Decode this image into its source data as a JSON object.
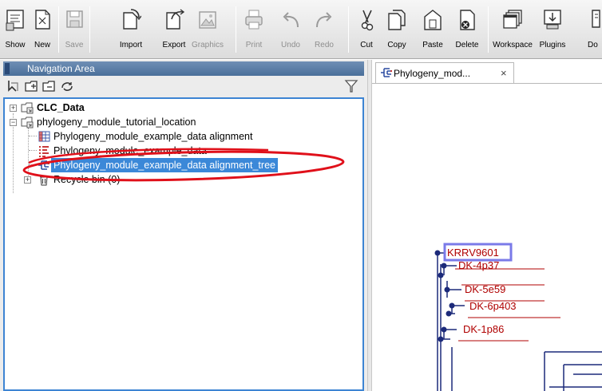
{
  "toolbar": {
    "buttons": [
      {
        "label": "Show",
        "enabled": true,
        "icon": "show-icon"
      },
      {
        "label": "New",
        "enabled": true,
        "icon": "new-icon"
      },
      {
        "label": "Save",
        "enabled": false,
        "icon": "save-icon"
      },
      {
        "label": "Import",
        "enabled": true,
        "icon": "import-icon"
      },
      {
        "label": "Export",
        "enabled": true,
        "icon": "export-icon"
      },
      {
        "label": "Graphics",
        "enabled": false,
        "icon": "graphics-icon"
      },
      {
        "label": "Print",
        "enabled": false,
        "icon": "print-icon"
      },
      {
        "label": "Undo",
        "enabled": false,
        "icon": "undo-icon"
      },
      {
        "label": "Redo",
        "enabled": false,
        "icon": "redo-icon"
      },
      {
        "label": "Cut",
        "enabled": true,
        "icon": "cut-icon"
      },
      {
        "label": "Copy",
        "enabled": true,
        "icon": "copy-icon"
      },
      {
        "label": "Paste",
        "enabled": true,
        "icon": "paste-icon"
      },
      {
        "label": "Delete",
        "enabled": true,
        "icon": "delete-icon"
      },
      {
        "label": "Workspace",
        "enabled": true,
        "icon": "workspace-icon"
      },
      {
        "label": "Plugins",
        "enabled": true,
        "icon": "plugins-icon"
      },
      {
        "label": "Do",
        "enabled": true,
        "icon": "download-icon"
      }
    ]
  },
  "navigation": {
    "title": "Navigation Area",
    "tools": [
      "add-folder-icon",
      "new-folder-icon",
      "refresh-icon",
      "filter-icon"
    ],
    "tree": {
      "root": {
        "label": "CLC_Data",
        "expanded": false,
        "icon": "folder-icon"
      },
      "location": {
        "label": "phylogeny_module_tutorial_location",
        "expanded": true,
        "icon": "folder-icon"
      },
      "children": [
        {
          "label": "Phylogeny_module_example_data alignment",
          "icon": "alignment-icon",
          "selected": false
        },
        {
          "label": "Phylogeny_module_example_data",
          "icon": "sequence-list-icon",
          "selected": false
        },
        {
          "label": "Phylogeny_module_example_data alignment_tree",
          "icon": "tree-icon",
          "selected": true
        }
      ],
      "recycle_bin": {
        "label": "Recycle bin (0)",
        "icon": "trash-icon"
      }
    },
    "highlight_color": "#e0101a"
  },
  "editor": {
    "tab": {
      "label": "Phylogeny_mod...",
      "close": "×",
      "icon": "tree-icon"
    },
    "leaves": [
      "KRRV9601",
      "DK-4p37",
      "DK-5e59",
      "DK-6p403",
      "DK-1p86"
    ],
    "colors": {
      "branch": "#1c2a7a",
      "leaf_text": "#b00000",
      "leaf_underline": "#b00000",
      "selection_box": "#7a7ae8"
    }
  }
}
